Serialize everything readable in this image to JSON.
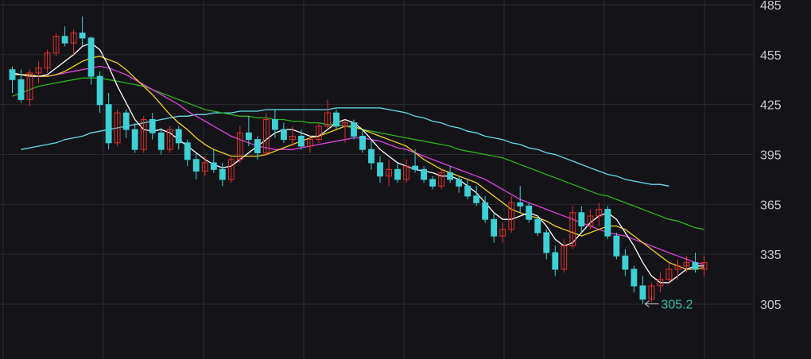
{
  "chart_data": {
    "type": "candlestick",
    "y_ticks": [
      "485",
      "455",
      "425",
      "395",
      "365",
      "335",
      "305"
    ],
    "y_tick_values": [
      485,
      455,
      425,
      395,
      365,
      335,
      305
    ],
    "ylim": [
      290,
      488
    ],
    "grid": true,
    "low_marker_label": "305.2",
    "low_marker_value": 305.2,
    "colors": {
      "background": "#141418",
      "grid": "#2a2a30",
      "up": "#e0302c",
      "down": "#3fd0d6",
      "ma5": "#ffffff",
      "ma10": "#f5d320",
      "ma20": "#e040e0",
      "ma60": "#2fb020",
      "ma120": "#68dcec",
      "low_label": "#2fc2a8"
    },
    "candles": [
      [
        446,
        448,
        432,
        440
      ],
      [
        440,
        446,
        426,
        428
      ],
      [
        428,
        446,
        424,
        444
      ],
      [
        444,
        451,
        438,
        447
      ],
      [
        447,
        458,
        444,
        456
      ],
      [
        456,
        468,
        454,
        466
      ],
      [
        466,
        472,
        460,
        462
      ],
      [
        462,
        470,
        455,
        468
      ],
      [
        468,
        478,
        460,
        465
      ],
      [
        465,
        466,
        437,
        442
      ],
      [
        442,
        445,
        420,
        425
      ],
      [
        425,
        432,
        398,
        402
      ],
      [
        402,
        422,
        400,
        420
      ],
      [
        420,
        422,
        405,
        410
      ],
      [
        410,
        414,
        396,
        398
      ],
      [
        398,
        418,
        396,
        416
      ],
      [
        416,
        420,
        404,
        408
      ],
      [
        408,
        411,
        395,
        398
      ],
      [
        398,
        412,
        396,
        410
      ],
      [
        410,
        412,
        398,
        402
      ],
      [
        402,
        404,
        388,
        392
      ],
      [
        392,
        396,
        380,
        385
      ],
      [
        385,
        394,
        382,
        390
      ],
      [
        390,
        398,
        384,
        386
      ],
      [
        386,
        390,
        376,
        380
      ],
      [
        380,
        394,
        378,
        392
      ],
      [
        392,
        412,
        390,
        408
      ],
      [
        408,
        418,
        400,
        404
      ],
      [
        404,
        406,
        392,
        396
      ],
      [
        396,
        420,
        394,
        416
      ],
      [
        416,
        422,
        405,
        410
      ],
      [
        410,
        414,
        402,
        404
      ],
      [
        404,
        412,
        400,
        406
      ],
      [
        406,
        410,
        398,
        400
      ],
      [
        400,
        406,
        396,
        404
      ],
      [
        404,
        414,
        402,
        412
      ],
      [
        412,
        428,
        410,
        420
      ],
      [
        420,
        422,
        410,
        412
      ],
      [
        412,
        416,
        402,
        414
      ],
      [
        414,
        416,
        404,
        406
      ],
      [
        406,
        410,
        396,
        398
      ],
      [
        398,
        404,
        386,
        390
      ],
      [
        390,
        394,
        378,
        382
      ],
      [
        382,
        392,
        376,
        386
      ],
      [
        386,
        390,
        378,
        380
      ],
      [
        380,
        392,
        378,
        388
      ],
      [
        388,
        398,
        384,
        386
      ],
      [
        386,
        388,
        378,
        380
      ],
      [
        380,
        382,
        374,
        376
      ],
      [
        376,
        386,
        374,
        384
      ],
      [
        384,
        388,
        378,
        380
      ],
      [
        380,
        382,
        372,
        376
      ],
      [
        376,
        380,
        368,
        370
      ],
      [
        370,
        376,
        364,
        366
      ],
      [
        366,
        370,
        354,
        356
      ],
      [
        356,
        360,
        342,
        346
      ],
      [
        346,
        354,
        342,
        350
      ],
      [
        350,
        370,
        348,
        366
      ],
      [
        366,
        376,
        360,
        364
      ],
      [
        364,
        366,
        354,
        356
      ],
      [
        356,
        358,
        346,
        348
      ],
      [
        348,
        350,
        332,
        336
      ],
      [
        336,
        340,
        322,
        326
      ],
      [
        326,
        344,
        324,
        340
      ],
      [
        340,
        364,
        338,
        360
      ],
      [
        360,
        364,
        348,
        352
      ],
      [
        352,
        362,
        350,
        358
      ],
      [
        358,
        366,
        352,
        362
      ],
      [
        362,
        364,
        344,
        346
      ],
      [
        346,
        348,
        332,
        334
      ],
      [
        334,
        338,
        322,
        326
      ],
      [
        326,
        328,
        312,
        316
      ],
      [
        316,
        322,
        305.2,
        308
      ],
      [
        308,
        318,
        306,
        316
      ],
      [
        316,
        324,
        312,
        320
      ],
      [
        320,
        330,
        318,
        326
      ],
      [
        326,
        332,
        320,
        328
      ],
      [
        328,
        334,
        324,
        330
      ],
      [
        330,
        336,
        324,
        326
      ],
      [
        326,
        334,
        322,
        330
      ]
    ],
    "ma5": [
      444,
      443,
      442,
      442,
      443,
      447,
      451,
      455,
      460,
      462,
      458,
      448,
      436,
      426,
      416,
      410,
      409,
      410,
      408,
      404,
      400,
      396,
      392,
      389,
      387,
      388,
      392,
      396,
      400,
      404,
      408,
      410,
      410,
      408,
      406,
      406,
      410,
      414,
      416,
      414,
      410,
      404,
      398,
      394,
      390,
      388,
      386,
      385,
      384,
      382,
      382,
      380,
      376,
      372,
      366,
      360,
      356,
      356,
      358,
      360,
      358,
      352,
      344,
      340,
      342,
      348,
      354,
      358,
      360,
      356,
      348,
      340,
      330,
      322,
      318,
      318,
      322,
      326,
      328,
      328
    ],
    "ma10": [
      443,
      443,
      443,
      442,
      442,
      443,
      445,
      448,
      451,
      453,
      454,
      452,
      450,
      446,
      441,
      436,
      431,
      425,
      419,
      414,
      410,
      405,
      401,
      398,
      396,
      394,
      394,
      394,
      394,
      395,
      397,
      399,
      401,
      403,
      405,
      406,
      408,
      410,
      412,
      412,
      410,
      408,
      406,
      404,
      402,
      400,
      396,
      392,
      389,
      386,
      384,
      382,
      380,
      378,
      374,
      370,
      366,
      362,
      360,
      358,
      357,
      355,
      352,
      350,
      348,
      346,
      348,
      350,
      352,
      352,
      350,
      346,
      342,
      338,
      334,
      330,
      328,
      326,
      326,
      327
    ],
    "ma20": [
      444,
      443,
      443,
      442,
      442,
      443,
      444,
      445,
      446,
      447,
      448,
      447,
      445,
      443,
      440,
      437,
      434,
      431,
      428,
      425,
      421,
      418,
      415,
      412,
      409,
      406,
      404,
      402,
      400,
      399,
      398,
      398,
      398,
      399,
      400,
      401,
      402,
      403,
      404,
      405,
      405,
      404,
      403,
      401,
      399,
      398,
      396,
      394,
      392,
      390,
      388,
      386,
      384,
      382,
      380,
      377,
      374,
      371,
      368,
      366,
      364,
      362,
      360,
      358,
      356,
      354,
      352,
      350,
      348,
      347,
      346,
      344,
      342,
      340,
      338,
      336,
      334,
      332,
      330,
      329
    ],
    "ma60": [
      430,
      432,
      434,
      436,
      437,
      438,
      439,
      440,
      441,
      441,
      441,
      440,
      439,
      438,
      437,
      436,
      434,
      432,
      430,
      428,
      426,
      424,
      422,
      421,
      420,
      419,
      418,
      418,
      417,
      417,
      416,
      416,
      415,
      415,
      414,
      414,
      413,
      413,
      412,
      411,
      410,
      409,
      408,
      407,
      406,
      405,
      404,
      403,
      402,
      401,
      400,
      398,
      397,
      396,
      395,
      394,
      393,
      391,
      389,
      387,
      385,
      383,
      381,
      379,
      377,
      375,
      373,
      371,
      370,
      368,
      366,
      364,
      362,
      360,
      358,
      356,
      355,
      353,
      351,
      350
    ],
    "ma120": [
      null,
      398,
      399,
      400,
      401,
      402,
      404,
      405,
      406,
      408,
      409,
      410,
      411,
      412,
      413,
      414,
      415,
      416,
      417,
      418,
      418,
      419,
      419,
      420,
      420,
      420,
      421,
      421,
      421,
      422,
      422,
      422,
      422,
      422,
      422,
      422,
      422,
      423,
      423,
      423,
      423,
      423,
      423,
      422,
      421,
      420,
      418,
      417,
      415,
      414,
      412,
      411,
      409,
      408,
      406,
      405,
      404,
      402,
      401,
      399,
      398,
      396,
      395,
      393,
      391,
      389,
      387,
      385,
      383,
      382,
      380,
      379,
      378,
      377,
      377,
      376,
      null,
      null,
      null,
      null
    ]
  }
}
